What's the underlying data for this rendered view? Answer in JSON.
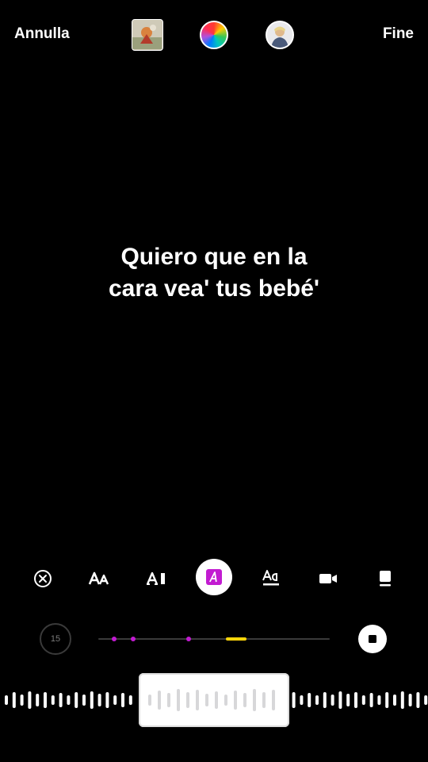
{
  "header": {
    "cancel_label": "Annulla",
    "done_label": "Fine"
  },
  "lyrics": {
    "line1": "Quiero que en la",
    "line2": "cara vea' tus bebé'"
  },
  "toolbar": {
    "active_tool": "highlight-text-style",
    "tools": [
      "remove-lyrics",
      "font-size",
      "typewriter-style",
      "highlight-text-style",
      "text-caption-style",
      "video-clip",
      "sticker-style"
    ]
  },
  "controls": {
    "duration": "15",
    "progress_markers": [
      0.07,
      0.15,
      0.39
    ],
    "selected_segment": [
      0.55,
      0.64
    ]
  },
  "colors": {
    "accent_pink": "#c21bd1",
    "selection_yellow": "#ffd60a"
  }
}
